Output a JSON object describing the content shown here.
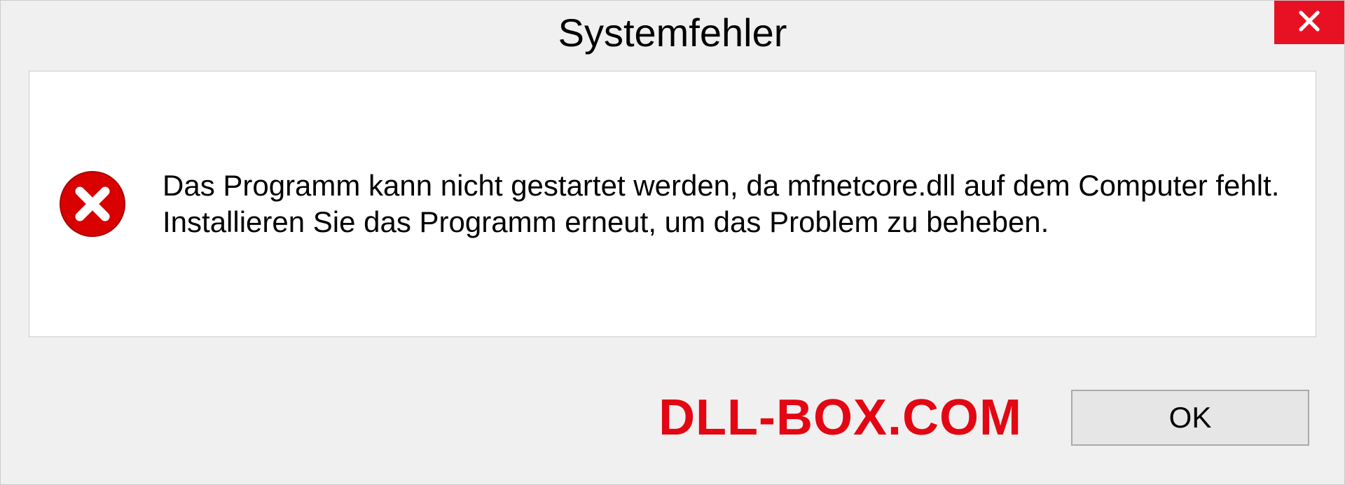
{
  "dialog": {
    "title": "Systemfehler",
    "message": "Das Programm kann nicht gestartet werden, da mfnetcore.dll auf dem Computer fehlt. Installieren Sie das Programm erneut, um das Problem zu beheben.",
    "ok_label": "OK"
  },
  "watermark": "DLL-BOX.COM",
  "colors": {
    "close_bg": "#e81123",
    "error_icon": "#d90000",
    "watermark": "#e30613"
  }
}
